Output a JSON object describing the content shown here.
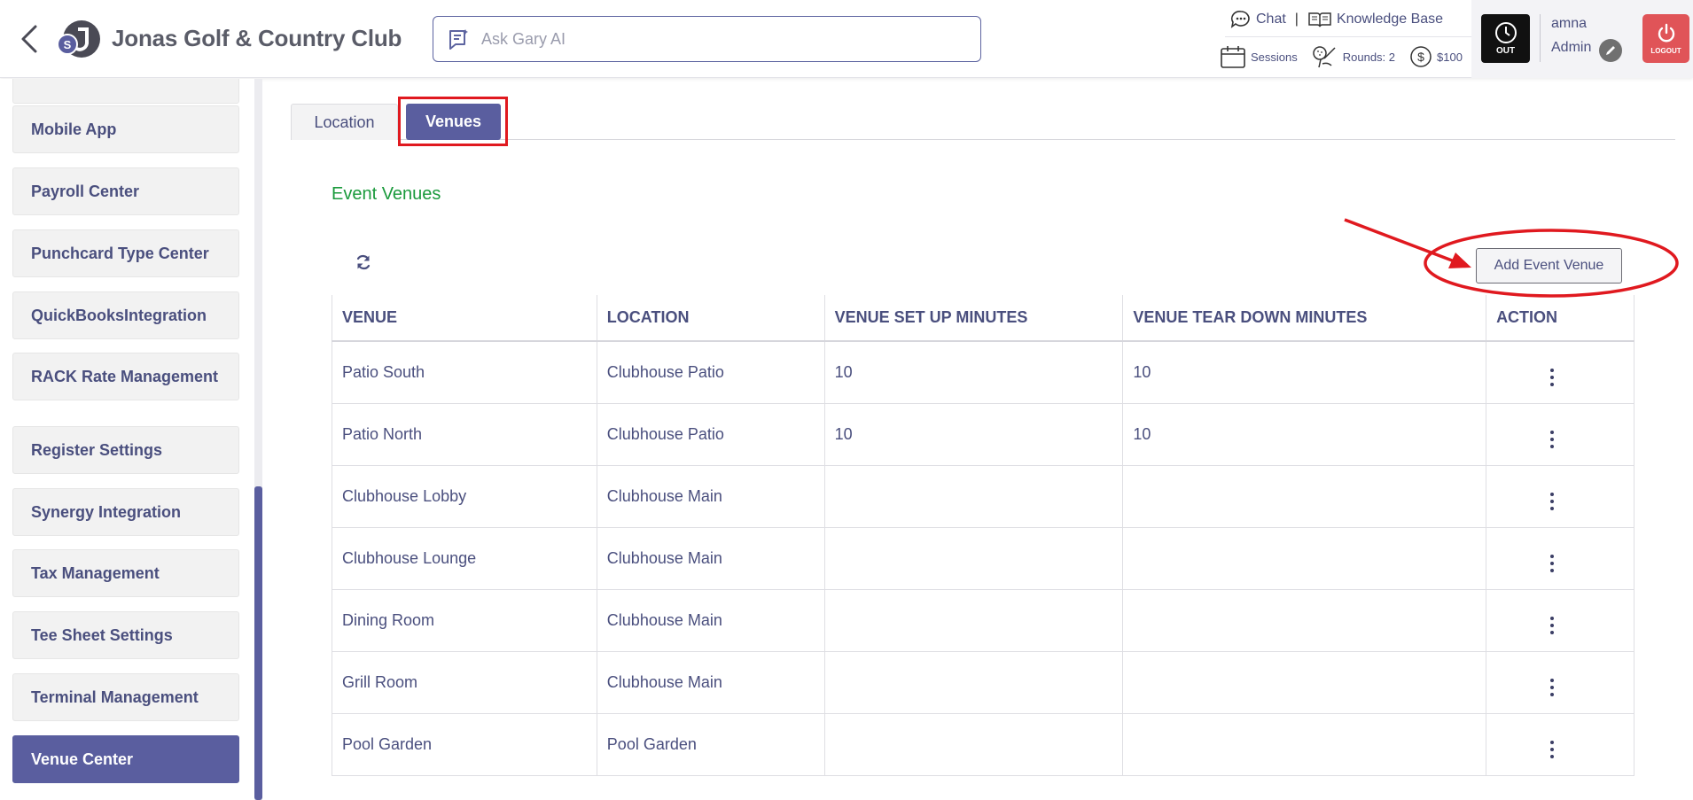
{
  "header": {
    "club_name": "Jonas Golf & Country Club",
    "ask_placeholder": "Ask Gary AI",
    "chat_label": "Chat",
    "separator": "|",
    "kb_label": "Knowledge Base",
    "sessions_label": "Sessions",
    "rounds_label": "Rounds: 2",
    "balance_label": "$100",
    "clock_label": "OUT",
    "user_name": "amna",
    "user_role": "Admin",
    "logout_label": "LOGOUT"
  },
  "sidebar": {
    "items": [
      {
        "label": "Mobile App"
      },
      {
        "label": "Payroll Center"
      },
      {
        "label": "Punchcard Type Center"
      },
      {
        "label": "QuickBooksIntegration"
      },
      {
        "label": "RACK Rate Management"
      },
      {
        "label": "Register Settings"
      },
      {
        "label": "Synergy Integration"
      },
      {
        "label": "Tax Management"
      },
      {
        "label": "Tee Sheet Settings"
      },
      {
        "label": "Terminal Management"
      },
      {
        "label": "Venue Center"
      }
    ],
    "active": "Venue Center"
  },
  "tabs": {
    "location": "Location",
    "venues": "Venues",
    "active": "Venues"
  },
  "section_title": "Event Venues",
  "add_button": "Add Event Venue",
  "table": {
    "headers": {
      "venue": "VENUE",
      "location": "LOCATION",
      "setup": "VENUE SET UP MINUTES",
      "teardown": "VENUE TEAR DOWN MINUTES",
      "action": "ACTION"
    },
    "rows": [
      {
        "venue": "Patio South",
        "location": "Clubhouse Patio",
        "setup": "10",
        "teardown": "10"
      },
      {
        "venue": "Patio North",
        "location": "Clubhouse Patio",
        "setup": "10",
        "teardown": "10"
      },
      {
        "venue": "Clubhouse Lobby",
        "location": "Clubhouse Main",
        "setup": "",
        "teardown": ""
      },
      {
        "venue": "Clubhouse Lounge",
        "location": "Clubhouse Main",
        "setup": "",
        "teardown": ""
      },
      {
        "venue": "Dining Room",
        "location": "Clubhouse Main",
        "setup": "",
        "teardown": ""
      },
      {
        "venue": "Grill Room",
        "location": "Clubhouse Main",
        "setup": "",
        "teardown": ""
      },
      {
        "venue": "Pool Garden",
        "location": "Pool Garden",
        "setup": "",
        "teardown": ""
      }
    ]
  },
  "colors": {
    "accent": "#5a5e9f",
    "section_title": "#1a9a3c",
    "annotation": "#e0191f",
    "logout": "#e05458"
  }
}
